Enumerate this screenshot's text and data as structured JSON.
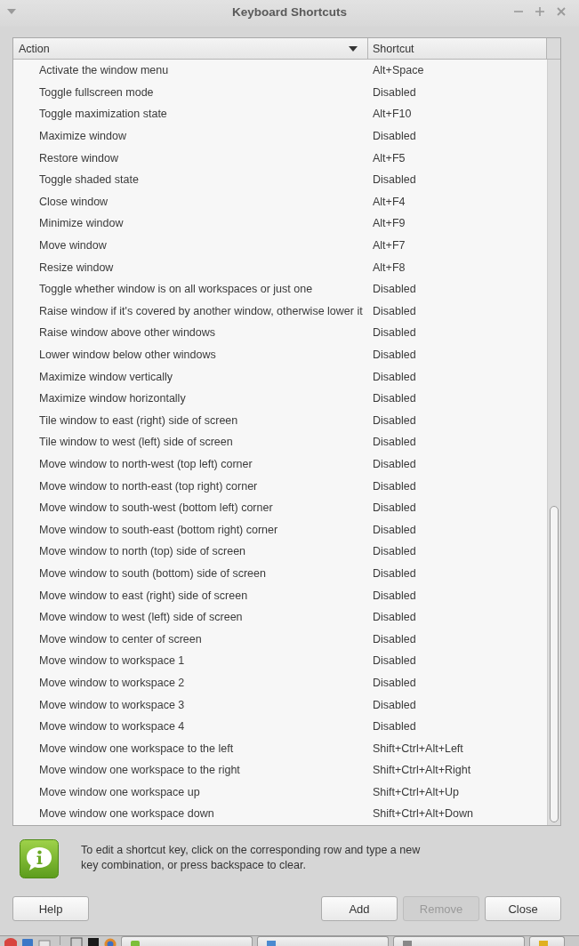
{
  "window": {
    "title": "Keyboard Shortcuts"
  },
  "table": {
    "columns": [
      {
        "label": "Action",
        "sort_indicator": true
      },
      {
        "label": "Shortcut",
        "sort_indicator": false
      }
    ],
    "rows": [
      {
        "action": "Activate the window menu",
        "shortcut": "Alt+Space"
      },
      {
        "action": "Toggle fullscreen mode",
        "shortcut": "Disabled"
      },
      {
        "action": "Toggle maximization state",
        "shortcut": "Alt+F10"
      },
      {
        "action": "Maximize window",
        "shortcut": "Disabled"
      },
      {
        "action": "Restore window",
        "shortcut": "Alt+F5"
      },
      {
        "action": "Toggle shaded state",
        "shortcut": "Disabled"
      },
      {
        "action": "Close window",
        "shortcut": "Alt+F4"
      },
      {
        "action": "Minimize window",
        "shortcut": "Alt+F9"
      },
      {
        "action": "Move window",
        "shortcut": "Alt+F7"
      },
      {
        "action": "Resize window",
        "shortcut": "Alt+F8"
      },
      {
        "action": "Toggle whether window is on all workspaces or just one",
        "shortcut": "Disabled"
      },
      {
        "action": "Raise window if it's covered by another window, otherwise lower it",
        "shortcut": "Disabled"
      },
      {
        "action": "Raise window above other windows",
        "shortcut": "Disabled"
      },
      {
        "action": "Lower window below other windows",
        "shortcut": "Disabled"
      },
      {
        "action": "Maximize window vertically",
        "shortcut": "Disabled"
      },
      {
        "action": "Maximize window horizontally",
        "shortcut": "Disabled"
      },
      {
        "action": "Tile window to east (right) side of screen",
        "shortcut": "Disabled"
      },
      {
        "action": "Tile window to west (left) side of screen",
        "shortcut": "Disabled"
      },
      {
        "action": "Move window to north-west (top left) corner",
        "shortcut": "Disabled"
      },
      {
        "action": "Move window to north-east (top right) corner",
        "shortcut": "Disabled"
      },
      {
        "action": "Move window to south-west (bottom left) corner",
        "shortcut": "Disabled"
      },
      {
        "action": "Move window to south-east (bottom right) corner",
        "shortcut": "Disabled"
      },
      {
        "action": "Move window to north (top) side of screen",
        "shortcut": "Disabled"
      },
      {
        "action": "Move window to south (bottom) side of screen",
        "shortcut": "Disabled"
      },
      {
        "action": "Move window to east (right) side of screen",
        "shortcut": "Disabled"
      },
      {
        "action": "Move window to west (left) side of screen",
        "shortcut": "Disabled"
      },
      {
        "action": "Move window to center of screen",
        "shortcut": "Disabled"
      },
      {
        "action": "Move window to workspace 1",
        "shortcut": "Disabled"
      },
      {
        "action": "Move window to workspace 2",
        "shortcut": "Disabled"
      },
      {
        "action": "Move window to workspace 3",
        "shortcut": "Disabled"
      },
      {
        "action": "Move window to workspace 4",
        "shortcut": "Disabled"
      },
      {
        "action": "Move window one workspace to the left",
        "shortcut": "Shift+Ctrl+Alt+Left"
      },
      {
        "action": "Move window one workspace to the right",
        "shortcut": "Shift+Ctrl+Alt+Right"
      },
      {
        "action": "Move window one workspace up",
        "shortcut": "Shift+Ctrl+Alt+Up"
      },
      {
        "action": "Move window one workspace down",
        "shortcut": "Shift+Ctrl+Alt+Down"
      }
    ]
  },
  "info": {
    "text_lines": [
      "To edit a shortcut key, click on the corresponding row and type a new",
      "key combination, or press backspace to clear."
    ]
  },
  "help_button": {
    "label": "Help",
    "disabled": false
  },
  "action_buttons": [
    {
      "label": "Add",
      "disabled": false
    },
    {
      "label": "Remove",
      "disabled": true
    },
    {
      "label": "Close",
      "disabled": false
    }
  ]
}
